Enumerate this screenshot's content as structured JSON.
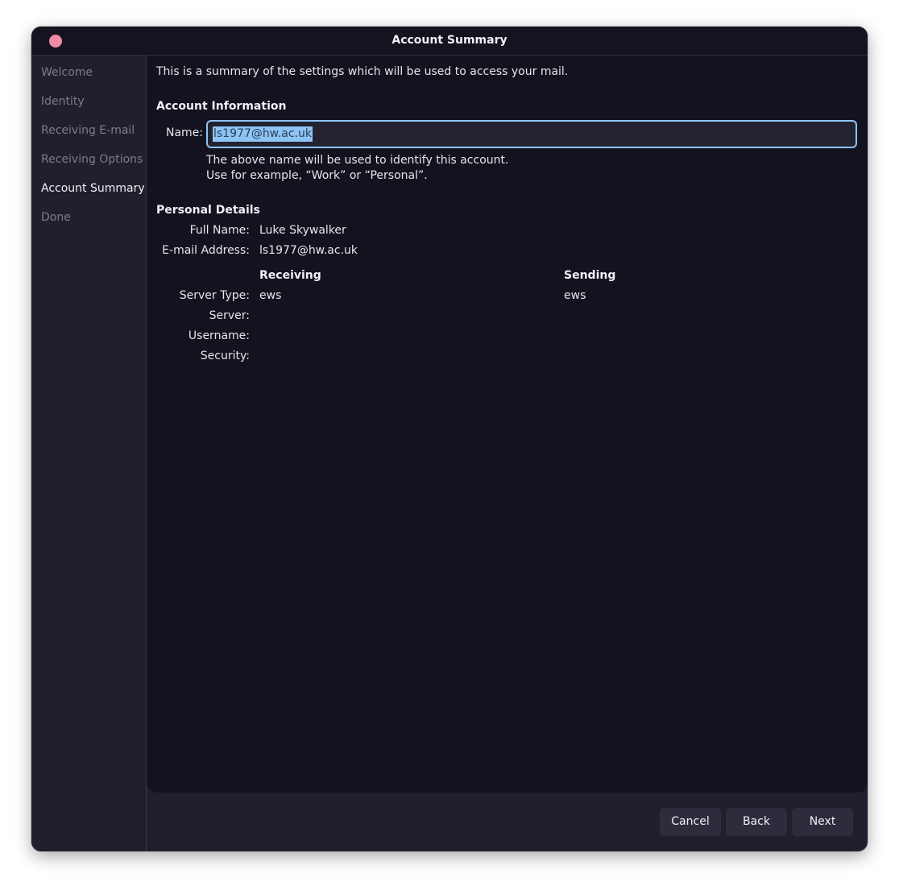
{
  "window": {
    "title": "Account Summary",
    "close_color": "#f08aa9"
  },
  "sidebar": {
    "items": [
      {
        "label": "Welcome",
        "active": false
      },
      {
        "label": "Identity",
        "active": false
      },
      {
        "label": "Receiving E-mail",
        "active": false
      },
      {
        "label": "Receiving Options",
        "active": false
      },
      {
        "label": "Account Summary",
        "active": true
      },
      {
        "label": "Done",
        "active": false
      }
    ]
  },
  "main": {
    "intro": "This is a summary of the settings which will be used to access your mail.",
    "account_info": {
      "heading": "Account Information",
      "name_label": "Name:",
      "name_value": "ls1977@hw.ac.uk",
      "hint_line1": "The above name will be used to identify this account.",
      "hint_line2": "Use for example, “Work” or “Personal”."
    },
    "personal_details": {
      "heading": "Personal Details",
      "full_name_label": "Full Name:",
      "full_name_value": "Luke Skywalker",
      "email_label": "E-mail Address:",
      "email_value": "ls1977@hw.ac.uk"
    },
    "servers": {
      "receiving_heading": "Receiving",
      "sending_heading": "Sending",
      "rows": [
        {
          "label": "Server Type:",
          "receiving": "ews",
          "sending": "ews"
        },
        {
          "label": "Server:",
          "receiving": "",
          "sending": ""
        },
        {
          "label": "Username:",
          "receiving": "",
          "sending": ""
        },
        {
          "label": "Security:",
          "receiving": "",
          "sending": ""
        }
      ]
    }
  },
  "footer": {
    "cancel_label": "Cancel",
    "back_label": "Back",
    "next_label": "Next"
  }
}
